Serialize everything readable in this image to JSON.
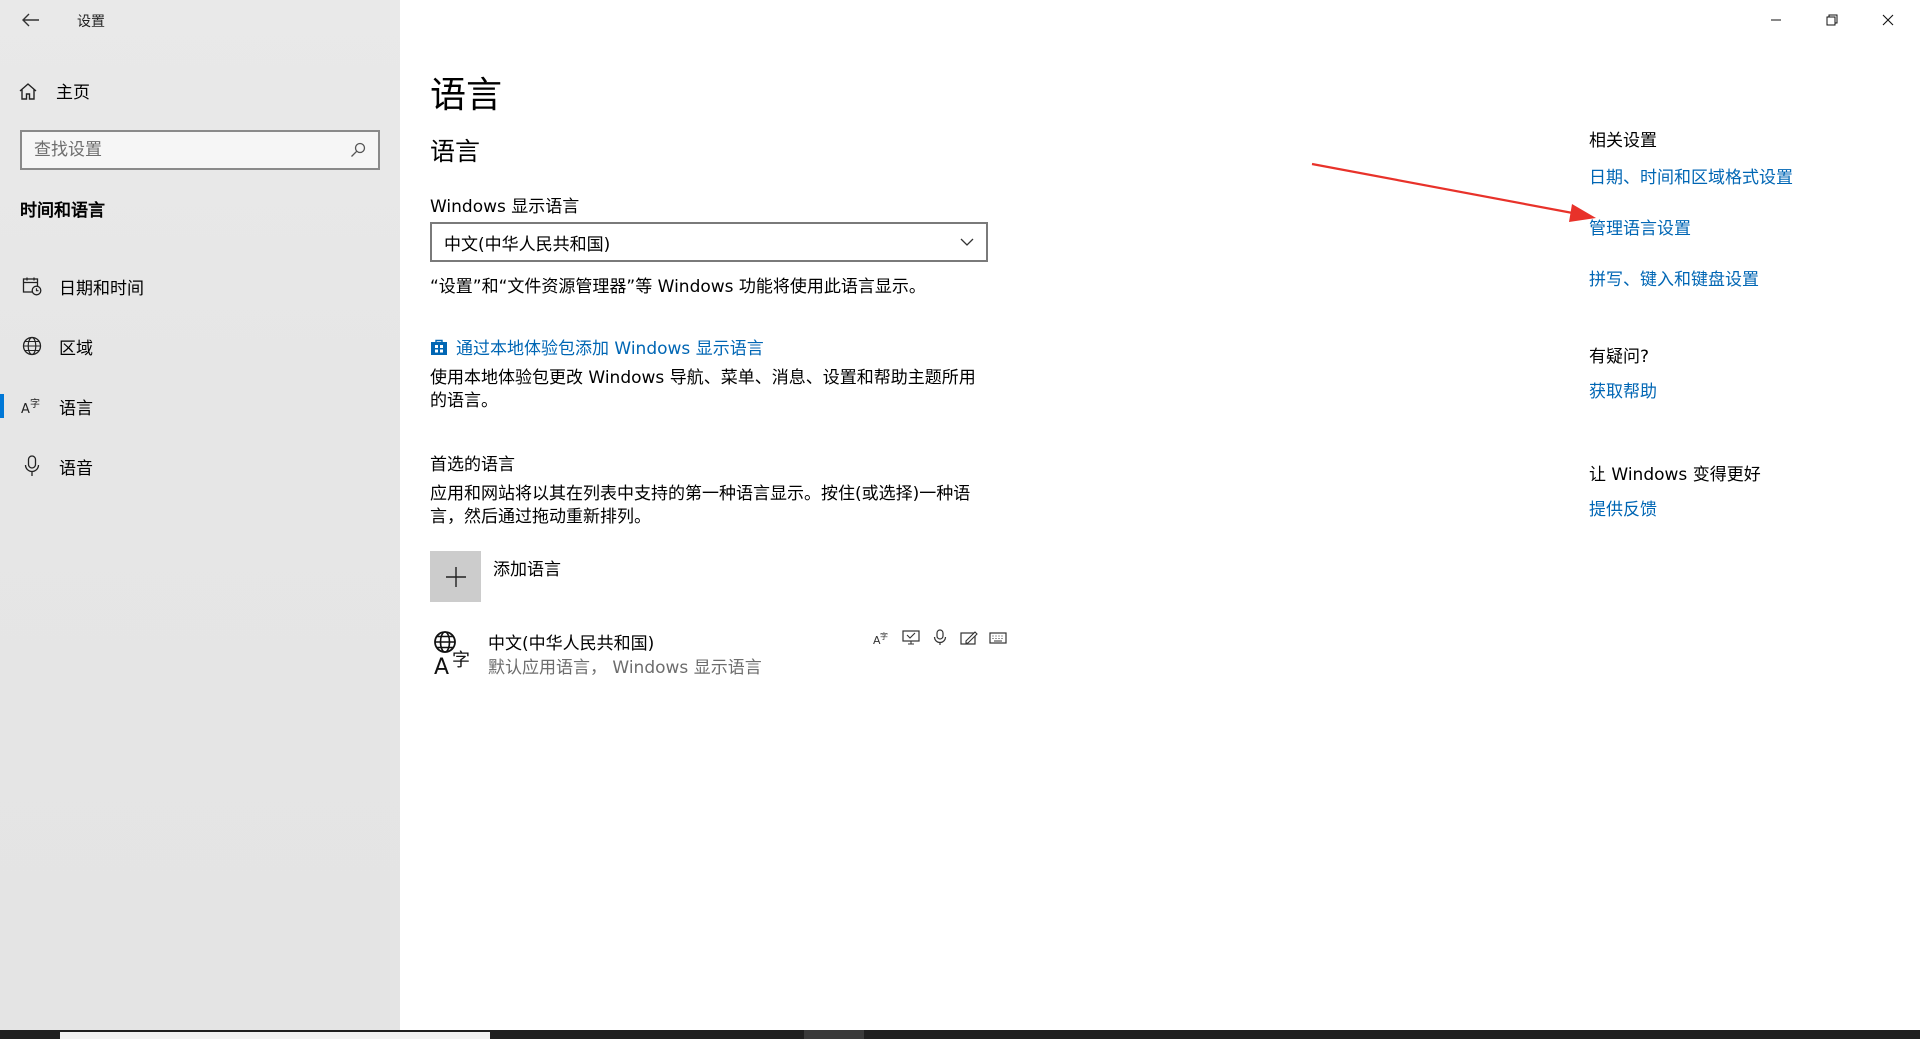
{
  "window": {
    "title": "设置"
  },
  "sidebar": {
    "home_label": "主页",
    "search_placeholder": "查找设置",
    "section_title": "时间和语言",
    "items": [
      {
        "label": "日期和时间",
        "icon": "calendar-clock-icon"
      },
      {
        "label": "区域",
        "icon": "globe-icon"
      },
      {
        "label": "语言",
        "icon": "language-icon",
        "active": true
      },
      {
        "label": "语音",
        "icon": "microphone-icon"
      }
    ]
  },
  "main": {
    "page_title": "语言",
    "section_heading": "语言",
    "display_language_label": "Windows 显示语言",
    "display_language_value": "中文(中华人民共和国)",
    "display_language_note": "“设置”和“文件资源管理器”等 Windows 功能将使用此语言显示。",
    "store_link": "通过本地体验包添加 Windows 显示语言",
    "store_desc": "使用本地体验包更改 Windows 导航、菜单、消息、设置和帮助主题所用的语言。",
    "preferred_heading": "首选的语言",
    "preferred_desc": "应用和网站将以其在列表中支持的第一种语言显示。按住(或选择)一种语言，然后通过拖动重新排列。",
    "add_language_label": "添加语言",
    "languages": [
      {
        "name": "中文(中华人民共和国)",
        "detail": "默认应用语言， Windows 显示语言"
      }
    ]
  },
  "related": {
    "heading": "相关设置",
    "links": [
      "日期、时间和区域格式设置",
      "管理语言设置",
      "拼写、键入和键盘设置"
    ],
    "help_heading": "有疑问?",
    "help_link": "获取帮助",
    "feedback_heading": "让 Windows 变得更好",
    "feedback_link": "提供反馈"
  },
  "colors": {
    "accent": "#0078d7",
    "link": "#0066b4",
    "annotation_arrow": "#e8322a"
  }
}
